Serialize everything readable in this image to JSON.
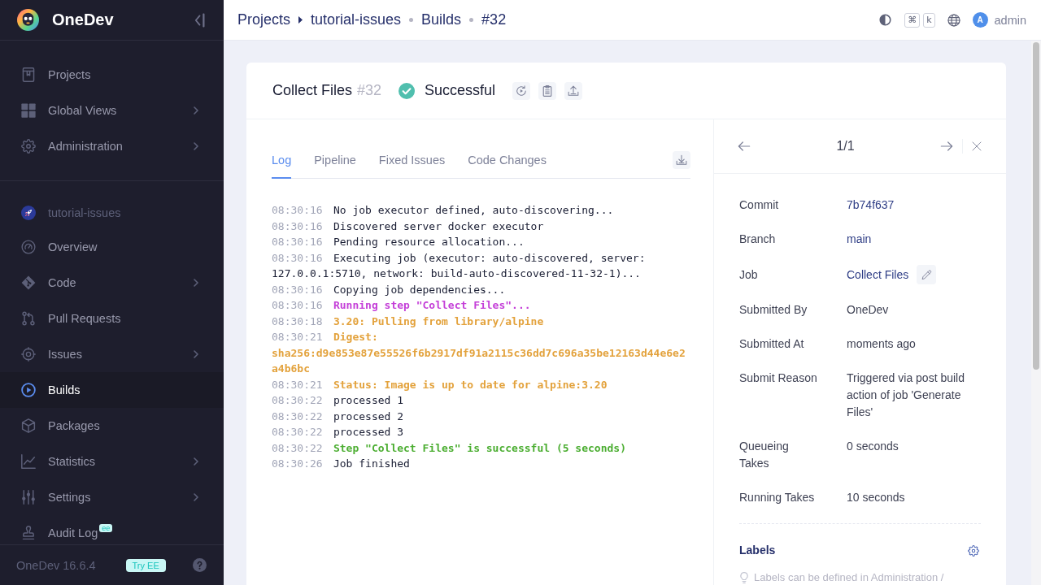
{
  "sidebar": {
    "brand": "OneDev",
    "global_items": [
      {
        "label": "Projects",
        "selected": false,
        "expandable": false
      },
      {
        "label": "Global Views",
        "selected": false,
        "expandable": true
      },
      {
        "label": "Administration",
        "selected": false,
        "expandable": true
      }
    ],
    "project": {
      "name": "tutorial-issues",
      "items": [
        {
          "label": "Overview",
          "selected": false,
          "expandable": false
        },
        {
          "label": "Code",
          "selected": false,
          "expandable": true
        },
        {
          "label": "Pull Requests",
          "selected": false,
          "expandable": false
        },
        {
          "label": "Issues",
          "selected": false,
          "expandable": true
        },
        {
          "label": "Builds",
          "selected": true,
          "expandable": false
        },
        {
          "label": "Packages",
          "selected": false,
          "expandable": false
        },
        {
          "label": "Statistics",
          "selected": false,
          "expandable": true
        },
        {
          "label": "Settings",
          "selected": false,
          "expandable": true
        },
        {
          "label": "Audit Log",
          "selected": false,
          "expandable": false,
          "badge": "ee"
        }
      ]
    },
    "footer": {
      "version": "OneDev 16.6.4",
      "upgrade_button": "Try EE"
    }
  },
  "topbar": {
    "breadcrumbs": [
      {
        "kind": "link",
        "label": "Projects"
      },
      {
        "kind": "caret"
      },
      {
        "kind": "link",
        "label": "tutorial-issues"
      },
      {
        "kind": "dot"
      },
      {
        "kind": "link",
        "label": "Builds"
      },
      {
        "kind": "dot"
      },
      {
        "kind": "link",
        "label": "#32"
      }
    ],
    "shortcut_keys": [
      "⌘",
      "k"
    ],
    "user": {
      "initial": "A",
      "name": "admin"
    }
  },
  "build": {
    "job": "Collect Files",
    "number": "#32",
    "status": {
      "kind": "successful",
      "label": "Successful"
    },
    "tabs": [
      {
        "label": "Log",
        "selected": true
      },
      {
        "label": "Pipeline",
        "selected": false
      },
      {
        "label": "Fixed Issues",
        "selected": false
      },
      {
        "label": "Code Changes",
        "selected": false
      }
    ],
    "log": [
      {
        "time": "08:30:16",
        "text": "No job executor defined, auto-discovering...",
        "kind": "plain"
      },
      {
        "time": "08:30:16",
        "text": "Discovered server docker executor",
        "kind": "plain"
      },
      {
        "time": "08:30:16",
        "text": "Pending resource allocation...",
        "kind": "plain"
      },
      {
        "time": "08:30:16",
        "text": "Executing job (executor: auto-discovered, server: 127.0.0.1:5710, network: build-auto-discovered-11-32-1)...",
        "kind": "plain"
      },
      {
        "time": "08:30:16",
        "text": "Copying job dependencies...",
        "kind": "plain"
      },
      {
        "time": "08:30:16",
        "text": "Running step \"Collect Files\"...",
        "kind": "step"
      },
      {
        "time": "08:30:18",
        "text": "3.20: Pulling from library/alpine",
        "kind": "output"
      },
      {
        "time": "08:30:21",
        "text": "Digest: sha256:d9e853e87e55526f6b2917df91a2115c36dd7c696a35be12163d44e6e2a4b6bc",
        "kind": "output"
      },
      {
        "time": "08:30:21",
        "text": "Status: Image is up to date for alpine:3.20",
        "kind": "output"
      },
      {
        "time": "08:30:22",
        "text": "processed 1",
        "kind": "plain"
      },
      {
        "time": "08:30:22",
        "text": "processed 2",
        "kind": "plain"
      },
      {
        "time": "08:30:22",
        "text": "processed 3",
        "kind": "plain"
      },
      {
        "time": "08:30:22",
        "text": "Step \"Collect Files\" is successful (5 seconds)",
        "kind": "success"
      },
      {
        "time": "08:30:26",
        "text": "Job finished",
        "kind": "plain"
      }
    ],
    "details": {
      "pager": "1/1",
      "fields": [
        {
          "label": "Commit",
          "value": "7b74f637",
          "kind": "link",
          "editable": false
        },
        {
          "label": "Branch",
          "value": "main",
          "kind": "link",
          "editable": false
        },
        {
          "label": "Job",
          "value": "Collect Files",
          "kind": "link",
          "editable": true
        },
        {
          "label": "Submitted By",
          "value": "OneDev",
          "kind": "text",
          "editable": false
        },
        {
          "label": "Submitted At",
          "value": "moments ago",
          "kind": "text",
          "editable": false
        },
        {
          "label": "Submit Reason",
          "value": "Triggered via post build action of job 'Generate Files'",
          "kind": "text",
          "editable": false
        },
        {
          "label": "Queueing Takes",
          "value": "0 seconds",
          "kind": "text",
          "editable": false
        },
        {
          "label": "Running Takes",
          "value": "10 seconds",
          "kind": "text",
          "editable": false
        }
      ],
      "labels": {
        "title": "Labels",
        "hint": "Labels can be defined in Administration /"
      }
    }
  }
}
